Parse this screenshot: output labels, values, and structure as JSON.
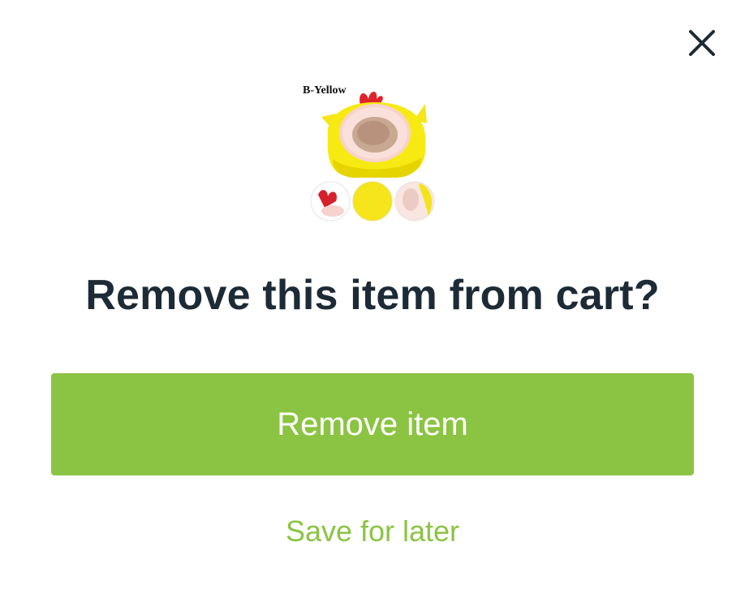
{
  "dialog": {
    "close_icon": "close-icon",
    "product": {
      "variant_label": "B-Yellow",
      "image_description_icon": "yellow-chick-pet-bed-image"
    },
    "title": "Remove this item from cart?",
    "primary_button": {
      "label": "Remove item",
      "color": "#8bc443"
    },
    "secondary_link": {
      "label": "Save for later",
      "color": "#8bc443"
    },
    "title_color": "#1c2b36"
  }
}
